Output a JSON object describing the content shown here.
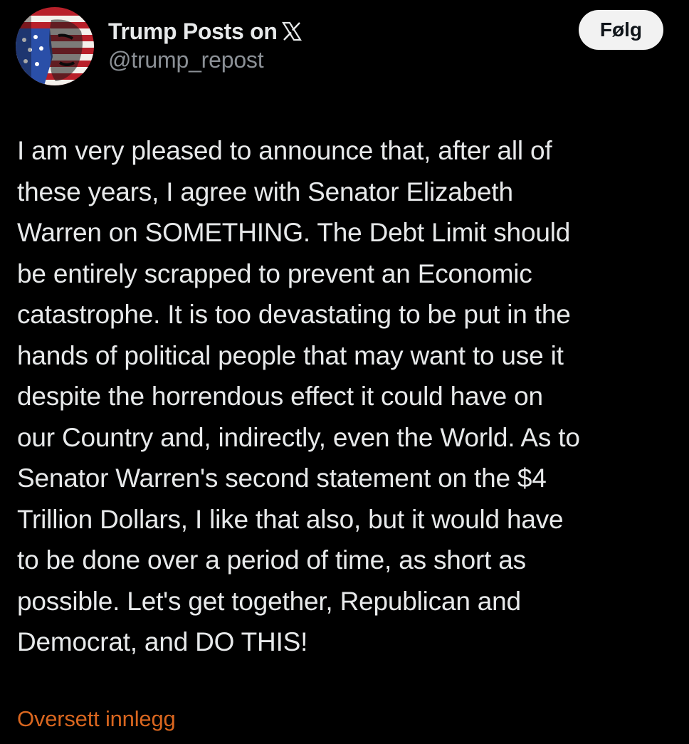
{
  "header": {
    "display_name": "Trump Posts on",
    "platform_icon": "x-logo-icon",
    "handle": "@trump_repost",
    "follow_label": "Følg"
  },
  "post": {
    "lines": [
      "I am very pleased to announce that, after all of",
      "these years, I agree with Senator Elizabeth",
      "Warren on SOMETHING. The Debt Limit should",
      "be entirely scrapped to prevent an Economic",
      "catastrophe. It is too devastating to be put in the",
      "hands of political people that may want to use it",
      "despite the horrendous effect it could have on",
      "our Country and, indirectly, even the World. As to",
      "Senator Warren's second statement on the $4",
      "Trillion Dollars, I like that also, but it would have",
      "to be done over a period of time, as short as",
      "possible. Let's get together, Republican and",
      "Democrat, and DO THIS!"
    ]
  },
  "footer": {
    "translate_label": "Oversett innlegg"
  },
  "colors": {
    "background": "#000000",
    "text": "#e7e9ea",
    "handle": "#8b9096",
    "translate_link": "#d9661f",
    "follow_bg": "#f2f2f2"
  }
}
